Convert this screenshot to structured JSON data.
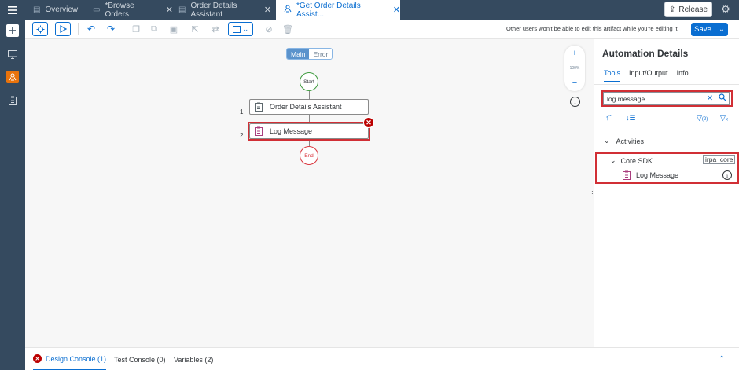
{
  "shell": {
    "tabs": [
      {
        "label": "Overview",
        "active": false
      },
      {
        "label": "*Browse Orders",
        "active": false
      },
      {
        "label": "Order Details Assistant",
        "active": false
      },
      {
        "label": "*Get Order Details Assist...",
        "active": true
      }
    ],
    "release_label": "Release"
  },
  "toolbar": {
    "note": "Other users won't be able to edit this artifact while you're editing it.",
    "save_label": "Save"
  },
  "canvas": {
    "segments": {
      "main": "Main",
      "error": "Error"
    },
    "start_label": "Start",
    "end_label": "End",
    "activities": [
      {
        "index": "1",
        "label": "Order Details Assistant"
      },
      {
        "index": "2",
        "label": "Log Message"
      }
    ],
    "zoom": {
      "in": "+",
      "level": "100%",
      "out": "−"
    }
  },
  "panel": {
    "title": "Automation Details",
    "tabs": [
      "Tools",
      "Input/Output",
      "Info"
    ],
    "search_value": "log message",
    "filter_count": "(2)",
    "section_label": "Activities",
    "group_label": "Core SDK",
    "group_package": "irpa_core",
    "item_label": "Log Message"
  },
  "console": {
    "tabs": [
      {
        "label": "Design Console (1)"
      },
      {
        "label": "Test Console (0)"
      },
      {
        "label": "Variables (2)"
      }
    ]
  },
  "colors": {
    "shell": "#354a5f",
    "accent": "#0a6ed1",
    "highlight": "#d12f35",
    "start": "#3e9b3e",
    "end": "#d9363e",
    "error": "#bb0000"
  }
}
